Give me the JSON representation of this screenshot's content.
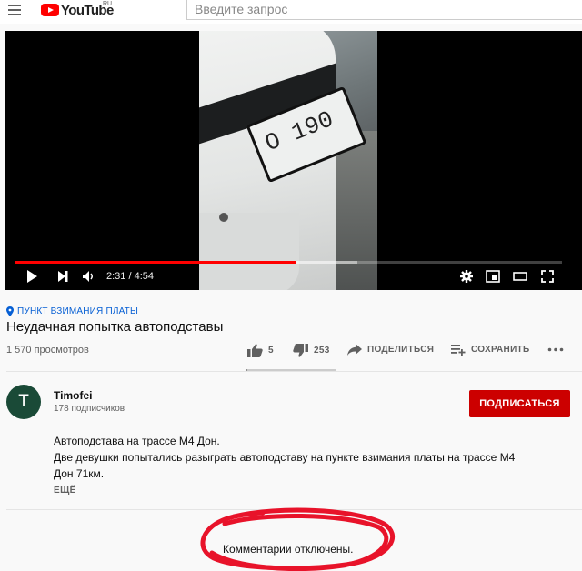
{
  "masthead": {
    "logo_text": "YouTube",
    "region": "RU",
    "search_placeholder": "Введите запрос"
  },
  "player": {
    "current_time": "2:31",
    "duration": "4:54",
    "time_display": "2:31 / 4:54",
    "played_fraction": 0.513,
    "buffered_fraction": 0.626,
    "frame_plate_text": "О 190",
    "accent_color": "#ff0000"
  },
  "video": {
    "location_label": "ПУНКТ ВЗИМАНИЯ ПЛАТЫ",
    "title": "Неудачная попытка автоподставы",
    "views": "1 570 просмотров",
    "likes": "5",
    "dislikes": "253",
    "like_fraction": 0.019,
    "share_label": "ПОДЕЛИТЬСЯ",
    "save_label": "СОХРАНИТЬ"
  },
  "channel": {
    "avatar_letter": "T",
    "avatar_color": "#1a4a37",
    "name": "Timofei",
    "subscribers": "178 подписчиков",
    "subscribe_label": "ПОДПИСАТЬСЯ",
    "subscribe_color": "#cc0000"
  },
  "description": {
    "lines": [
      "Автоподстава на трассе М4 Дон.",
      "Две девушки попытались разыграть автоподставу на пункте взимания платы на трассе М4",
      "Дон 71км."
    ],
    "more_label": "ЕЩЁ"
  },
  "comments": {
    "disabled_text": "Комментарии отключены.",
    "highlight_color": "#e8132a"
  },
  "icons": [
    "menu-icon",
    "youtube-logo-icon",
    "location-pin-icon",
    "play-icon",
    "next-icon",
    "volume-icon",
    "settings-icon",
    "miniplayer-icon",
    "theater-mode-icon",
    "fullscreen-icon",
    "like-icon",
    "dislike-icon",
    "share-icon",
    "save-playlist-icon",
    "more-icon"
  ]
}
